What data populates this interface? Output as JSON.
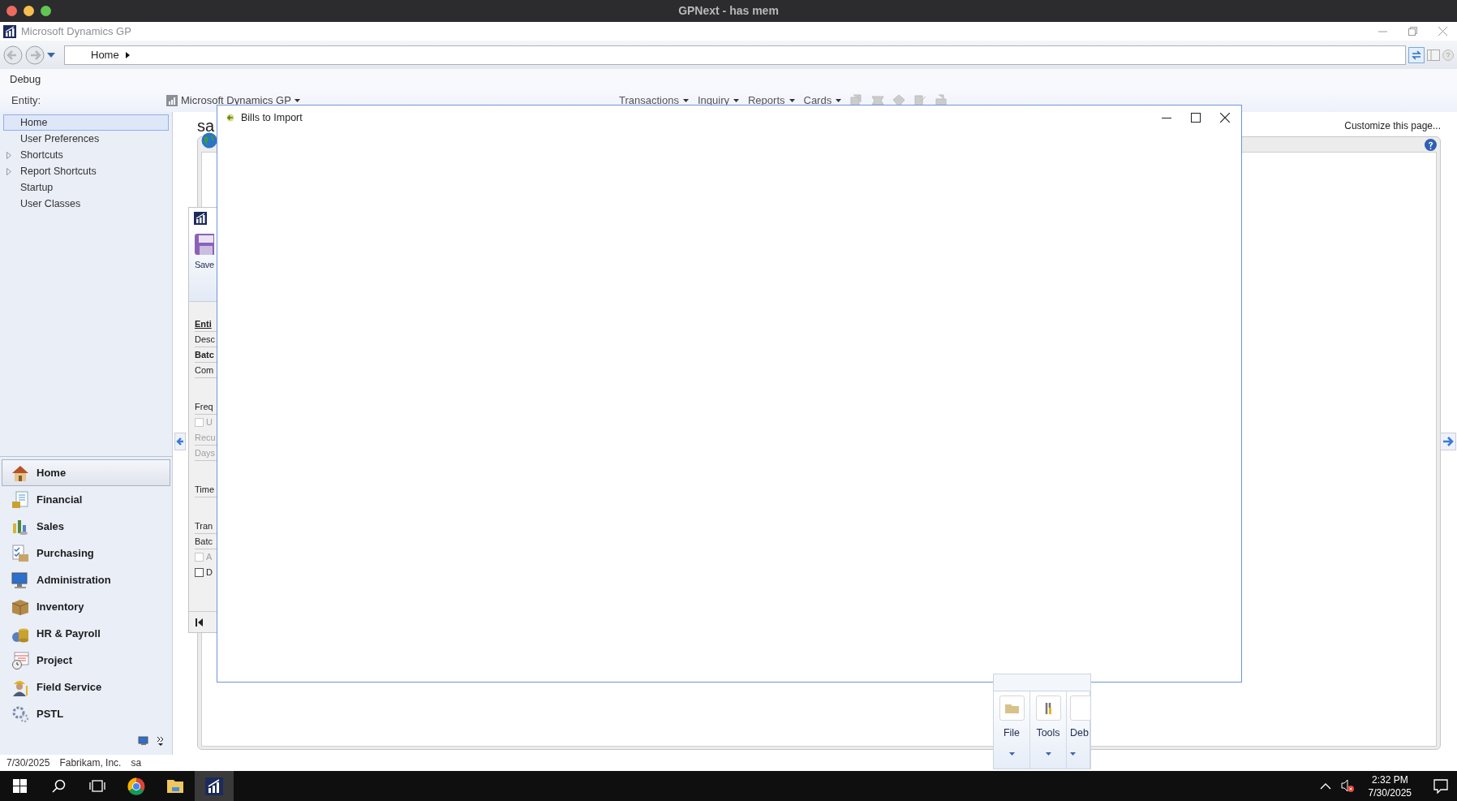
{
  "mac_window": {
    "title": "GPNext - has mem"
  },
  "app": {
    "title": "Microsoft Dynamics GP"
  },
  "address_bar": {
    "breadcrumb": "Home"
  },
  "menu": [
    "Debug"
  ],
  "entity_bar": {
    "label": "Entity:",
    "entity": "Microsoft Dynamics GP",
    "menus": [
      "Transactions",
      "Inquiry",
      "Reports",
      "Cards"
    ]
  },
  "sidebar": {
    "items": [
      {
        "label": "Home",
        "selected": true,
        "expandable": false
      },
      {
        "label": "User Preferences",
        "selected": false,
        "expandable": false
      },
      {
        "label": "Shortcuts",
        "selected": false,
        "expandable": true
      },
      {
        "label": "Report Shortcuts",
        "selected": false,
        "expandable": true
      },
      {
        "label": "Startup",
        "selected": false,
        "expandable": false
      },
      {
        "label": "User Classes",
        "selected": false,
        "expandable": false
      }
    ],
    "nav": [
      {
        "label": "Home",
        "selected": true
      },
      {
        "label": "Financial",
        "selected": false
      },
      {
        "label": "Sales",
        "selected": false
      },
      {
        "label": "Purchasing",
        "selected": false
      },
      {
        "label": "Administration",
        "selected": false
      },
      {
        "label": "Inventory",
        "selected": false
      },
      {
        "label": "HR & Payroll",
        "selected": false
      },
      {
        "label": "Project",
        "selected": false
      },
      {
        "label": "Field Service",
        "selected": false
      },
      {
        "label": "PSTL",
        "selected": false
      }
    ]
  },
  "home_page": {
    "user": "sa",
    "customize": "Customize this page..."
  },
  "background_window": {
    "save": "Save",
    "field_groups": [
      [
        {
          "kind": "heading",
          "label": "Enti"
        },
        {
          "kind": "text",
          "label": "Desc"
        },
        {
          "kind": "bold",
          "label": "Batc"
        },
        {
          "kind": "text",
          "label": "Com"
        }
      ],
      [
        {
          "kind": "text",
          "label": "Freq"
        },
        {
          "kind": "checkbox",
          "label": "U",
          "checked": false,
          "disabled": true
        },
        {
          "kind": "text",
          "label": "Recu",
          "disabled": true
        },
        {
          "kind": "text",
          "label": "Days",
          "disabled": true
        }
      ],
      [
        {
          "kind": "text",
          "label": "Time"
        }
      ],
      [
        {
          "kind": "text",
          "label": "Tran"
        },
        {
          "kind": "text",
          "label": "Batc"
        },
        {
          "kind": "checkbox",
          "label": "A",
          "checked": false,
          "disabled": true
        },
        {
          "kind": "checkbox",
          "label": "D",
          "checked": false,
          "disabled": false
        }
      ]
    ]
  },
  "dialog": {
    "title": "Bills to Import"
  },
  "ribbon_window": {
    "buttons": [
      "File",
      "Tools",
      "Deb"
    ]
  },
  "status_bar": [
    "7/30/2025",
    "Fabrikam, Inc.",
    "sa"
  ],
  "taskbar": {
    "apps": [
      {
        "selected": false
      },
      {
        "selected": false
      },
      {
        "selected": true
      }
    ],
    "time": "2:32 PM",
    "date": "7/30/2025"
  }
}
